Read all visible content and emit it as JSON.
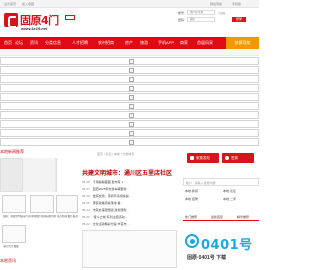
{
  "topbar": {
    "links": [
      "设为首页",
      "加入收藏",
      "网站导航",
      "手机版"
    ]
  },
  "logo": {
    "title": "固原4门",
    "url": "www.4x19.net"
  },
  "login": {
    "username_label": "帐号:",
    "username_placeholder": "用户名/手机",
    "password_label": "密码:",
    "password_placeholder": "密码",
    "remember_label": "记住",
    "login_button": "登录"
  },
  "search": {
    "placeholder": "搜索"
  },
  "nav": {
    "items": [
      "首页",
      "论坛",
      "资讯",
      "分类信息",
      "人才招聘",
      "农村招商",
      "房产",
      "旅游",
      "手机APP",
      "商家",
      "首届风采"
    ],
    "right_label": "快捷导航"
  },
  "section_left": {
    "title": "本地新闻推荐"
  },
  "meta_line": "首页 | 论坛 | 本地 | 分类信息",
  "headline": "共建文明城市：通川区五里店社区",
  "news": [
    {
      "date": "05-28",
      "text": "不用躲躲藏藏 发布有 1"
    },
    {
      "date": "05-27",
      "text": "固原2025年市政车辆更新..."
    },
    {
      "date": "05-26",
      "text": "发挥优势，营商环境持续提..."
    },
    {
      "date": "05-25",
      "text": "惠民政策持续落地 各..."
    },
    {
      "date": "05-24",
      "text": "市民办事更便捷 政务服务..."
    },
    {
      "date": "05-23",
      "text": "“奋斗之城”系列主题活动..."
    },
    {
      "date": "05-22",
      "text": "文化活动精彩纷呈 丰富市..."
    }
  ],
  "right_buttons": {
    "btn1": "家族发帖",
    "btn2": "签到"
  },
  "right_search": {
    "placeholder": "帐户 · 请输入搜索内容"
  },
  "right_tabs": [
    "热门推荐",
    "最新回复",
    "精华推荐"
  ],
  "right_links": [
    "本地·新闻",
    "本地·论坛",
    "本地·招聘",
    "本地·二手"
  ],
  "thumbs": [
    {
      "caption": "固原：共建文明城市行动"
    },
    {
      "caption": "本地图片新闻标题示例"
    },
    {
      "caption": "热点新闻 图片报道"
    },
    {
      "caption": "市民生活 图集"
    }
  ],
  "bottom_left": "本地资讯",
  "bottom_logo": {
    "text": "0401号",
    "sub": "固原·0401号 下载"
  }
}
